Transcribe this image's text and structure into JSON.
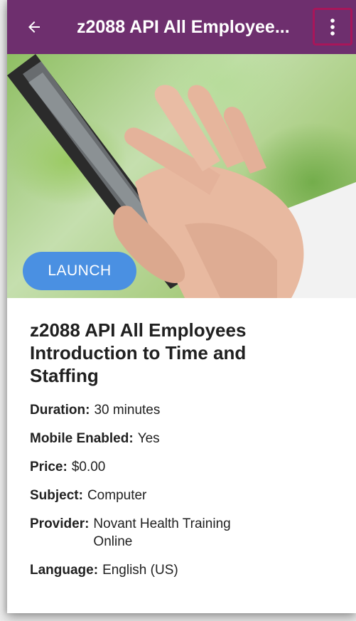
{
  "header": {
    "title": "z2088 API All Employee...",
    "back_icon": "arrow-back-icon",
    "menu_icon": "more-vert-icon",
    "background_color": "#6e2f6e",
    "menu_highlight_color": "#a8165a"
  },
  "hero": {
    "image_description_icon": "hand-tablet-image",
    "launch_label": "LAUNCH",
    "launch_color": "#4a90e2"
  },
  "course": {
    "title": "z2088 API All Employees Introduction to Time and Staffing",
    "fields": [
      {
        "label": "Duration:",
        "value": "30 minutes"
      },
      {
        "label": "Mobile Enabled:",
        "value": "Yes"
      },
      {
        "label": "Price:",
        "value": "$0.00"
      },
      {
        "label": "Subject:",
        "value": "Computer"
      },
      {
        "label": "Provider:",
        "value": "Novant Health Training Online"
      },
      {
        "label": "Language:",
        "value": "English (US)"
      }
    ]
  }
}
